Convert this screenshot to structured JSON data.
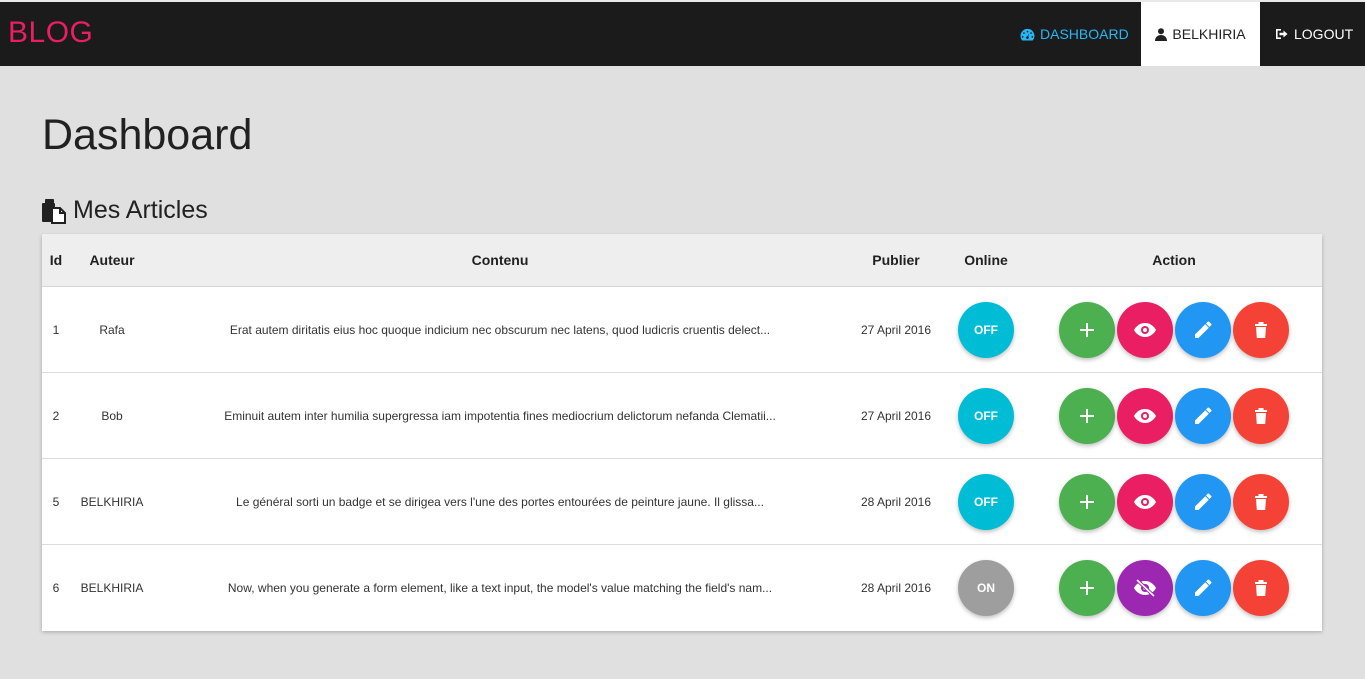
{
  "nav": {
    "brand": "BLOG",
    "dashboard": "DASHBOARD",
    "user": "BELKHIRIA",
    "logout": "LOGOUT"
  },
  "page": {
    "title": "Dashboard",
    "section": "Mes Articles"
  },
  "table": {
    "headers": {
      "id": "Id",
      "author": "Auteur",
      "content": "Contenu",
      "published": "Publier",
      "online": "Online",
      "action": "Action"
    },
    "rows": [
      {
        "id": "1",
        "author": "Rafa",
        "content": "Erat autem diritatis eius hoc quoque indicium nec obscurum nec latens, quod ludicris cruentis delect...",
        "date": "27 April 2016",
        "status": "OFF",
        "visibility": "visible"
      },
      {
        "id": "2",
        "author": "Bob",
        "content": "Eminuit autem inter humilia supergressa iam impotentia fines mediocrium delictorum nefanda Clematii...",
        "date": "27 April 2016",
        "status": "OFF",
        "visibility": "visible"
      },
      {
        "id": "5",
        "author": "BELKHIRIA",
        "content": "Le général sorti un badge et se dirigea vers l'une des portes entourées de peinture jaune. Il glissa...",
        "date": "28 April 2016",
        "status": "OFF",
        "visibility": "visible"
      },
      {
        "id": "6",
        "author": "BELKHIRIA",
        "content": "Now, when you generate a form element, like a text input, the model's value matching the field's nam...",
        "date": "28 April 2016",
        "status": "ON",
        "visibility": "hidden"
      }
    ]
  },
  "icons": {
    "dashboard": "dashboard-icon",
    "user": "user-icon",
    "logout": "logout-icon",
    "articles": "articles-icon",
    "add": "plus-icon",
    "view": "eye-icon",
    "view_hidden": "eye-slash-icon",
    "edit": "pencil-icon",
    "delete": "trash-icon"
  },
  "colors": {
    "brand": "#e91e63",
    "navbar": "#1b1b1b",
    "dashboard_link": "#29b6f6",
    "status_off": "#00bcd4",
    "status_on": "#9e9e9e",
    "add": "#4caf50",
    "view": "#e91e63",
    "view_hidden": "#9c27b0",
    "edit": "#2196f3",
    "delete": "#f44336"
  }
}
